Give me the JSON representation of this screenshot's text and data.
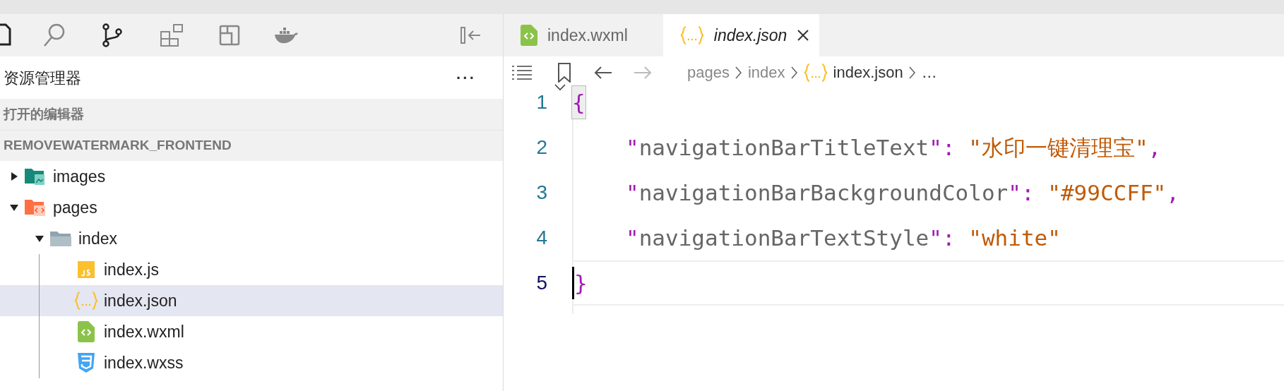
{
  "sidebar": {
    "title": "资源管理器",
    "more": "···",
    "open_editors": "打开的编辑器",
    "project": "REMOVEWATERMARK_FRONTEND",
    "tree": [
      {
        "kind": "folder-image",
        "label": "images",
        "expanded": false,
        "selected": false
      },
      {
        "kind": "folder-pages",
        "label": "pages",
        "expanded": true,
        "selected": false,
        "children": [
          {
            "kind": "folder",
            "label": "index",
            "expanded": true,
            "selected": false,
            "children": [
              {
                "kind": "js",
                "label": "index.js",
                "selected": false
              },
              {
                "kind": "json",
                "label": "index.json",
                "selected": true
              },
              {
                "kind": "wxml",
                "label": "index.wxml",
                "selected": false
              },
              {
                "kind": "wxss",
                "label": "index.wxss",
                "selected": false
              }
            ]
          }
        ]
      }
    ]
  },
  "editor": {
    "tabs": [
      {
        "kind": "wxml",
        "label": "index.wxml",
        "selected": false,
        "preview": false
      },
      {
        "kind": "json",
        "label": "index.json",
        "selected": true,
        "preview": true
      }
    ],
    "breadcrumb": [
      {
        "kind": "folder",
        "text": "pages"
      },
      {
        "kind": "folder",
        "text": "index"
      },
      {
        "kind": "json",
        "text": "index.json"
      },
      {
        "kind": "more",
        "text": "…"
      }
    ],
    "lines": [
      {
        "number": "1",
        "tokens": [
          {
            "kind": "brace",
            "text": "{"
          }
        ]
      },
      {
        "number": "2",
        "nested": true,
        "tokens": [
          {
            "kind": "quote",
            "text": "\""
          },
          {
            "kind": "key",
            "text": "navigationBarTitleText"
          },
          {
            "kind": "quote",
            "text": "\""
          },
          {
            "kind": "punct",
            "text": ": "
          },
          {
            "kind": "string",
            "text": "\"水印一键清理宝\""
          },
          {
            "kind": "plain",
            "text": ","
          }
        ]
      },
      {
        "number": "3",
        "nested": true,
        "tokens": [
          {
            "kind": "quote",
            "text": "\""
          },
          {
            "kind": "key",
            "text": "navigationBarBackgroundColor"
          },
          {
            "kind": "quote",
            "text": "\""
          },
          {
            "kind": "punct",
            "text": ": "
          },
          {
            "kind": "string",
            "text": "\"#99CCFF\""
          },
          {
            "kind": "plain",
            "text": ","
          }
        ]
      },
      {
        "number": "4",
        "nested": true,
        "tokens": [
          {
            "kind": "quote",
            "text": "\""
          },
          {
            "kind": "key",
            "text": "navigationBarTextStyle"
          },
          {
            "kind": "quote",
            "text": "\""
          },
          {
            "kind": "punct",
            "text": ": "
          },
          {
            "kind": "string",
            "text": "\"white\""
          }
        ]
      },
      {
        "number": "5",
        "tokens": [
          {
            "kind": "brace",
            "text": "}"
          }
        ],
        "current": true
      }
    ]
  }
}
